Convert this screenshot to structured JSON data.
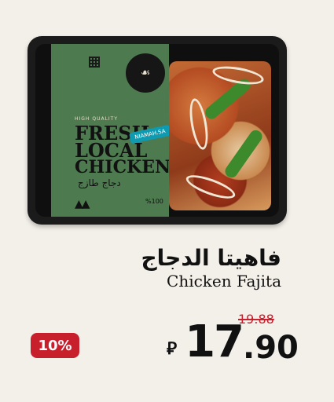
{
  "product": {
    "name_ar": "فاهيتا الدجاج",
    "name_en": "Chicken Fajita",
    "package": {
      "tagline": "HIGH QUALITY",
      "line1": "FRESH",
      "line2": "LOCAL",
      "line3": "CHICKEN",
      "arabic": "دجاج طازج",
      "percent": "%100",
      "stamp": "NIAMAH.SA"
    }
  },
  "pricing": {
    "old_price": "19.88",
    "price_int": "17",
    "price_dec": ".90",
    "currency_symbol": "⃁",
    "discount": "10%"
  },
  "colors": {
    "discount_bg": "#c81f2c",
    "old_price": "#c8202f",
    "label_green": "#4d7a4f"
  }
}
